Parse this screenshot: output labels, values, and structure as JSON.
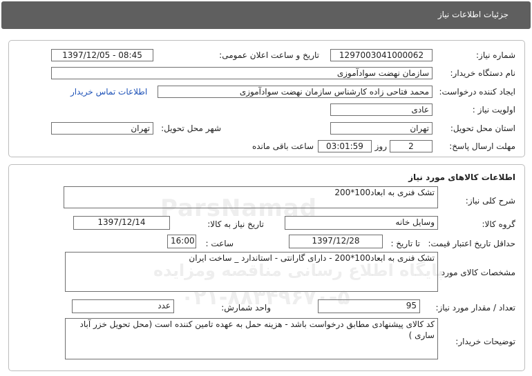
{
  "header": {
    "title": "جزئیات اطلاعات نیاز"
  },
  "info": {
    "need_number_label": "شماره نیاز:",
    "need_number": "1297003041000062",
    "announce_label": "تاریخ و ساعت اعلان عمومی:",
    "announce_value": "1397/12/05 - 08:45",
    "buyer_org_label": "نام دستگاه خریدار:",
    "buyer_org": "سازمان نهضت سوادآموزی",
    "creator_label": "ایجاد کننده درخواست:",
    "creator": "محمد فتاحی زاده کارشناس سازمان نهضت سوادآموزی",
    "contact_link": "اطلاعات تماس خریدار",
    "priority_label": "اولویت نیاز :",
    "priority": "عادی",
    "province_label": "استان محل تحویل:",
    "province": "تهران",
    "city_label": "شهر محل تحویل:",
    "city": "تهران",
    "deadline_label": "مهلت ارسال پاسخ:",
    "days": "2",
    "days_unit": "روز و",
    "time_left": "03:01:59",
    "time_left_label": "ساعت باقی مانده"
  },
  "goods": {
    "section_title": "اطلاعات کالاهای مورد نیاز",
    "desc_label": "شرح کلی نیاز:",
    "desc": "تشک فنری به ابعاد100*200",
    "group_label": "گروه کالا:",
    "group": "وسایل خانه",
    "need_date_label": "تاریخ نیاز به کالا:",
    "need_date": "1397/12/14",
    "validity_label": "حداقل تاریخ اعتبار قیمت:",
    "to_date_label": "تا تاریخ :",
    "to_date": "1397/12/28",
    "hour_label": "ساعت :",
    "hour": "16:00",
    "specs_label": "مشخصات کالای مورد نیاز:",
    "specs": "تشک فنری به ابعاد100*200 - دارای گارانتی - استاندارد _ ساخت ایران",
    "qty_label": "تعداد / مقدار مورد نیاز:",
    "qty": "95",
    "unit_label": "واحد شمارش:",
    "unit": "عدد",
    "buyer_notes_label": "توضیحات خریدار:",
    "buyer_notes": "کد کالای پیشنهادی مطابق درخواست باشد - هزینه حمل به عهده تامین کننده است (محل تحویل خزر آباد ساری )"
  },
  "watermark": {
    "brand": "ParsNamad",
    "line1": "پایگاه اطلاع رسانی مناقصه ومزایده",
    "line2": "۰۲۱-۸۸۳۴۹۶۷۰-۵"
  }
}
